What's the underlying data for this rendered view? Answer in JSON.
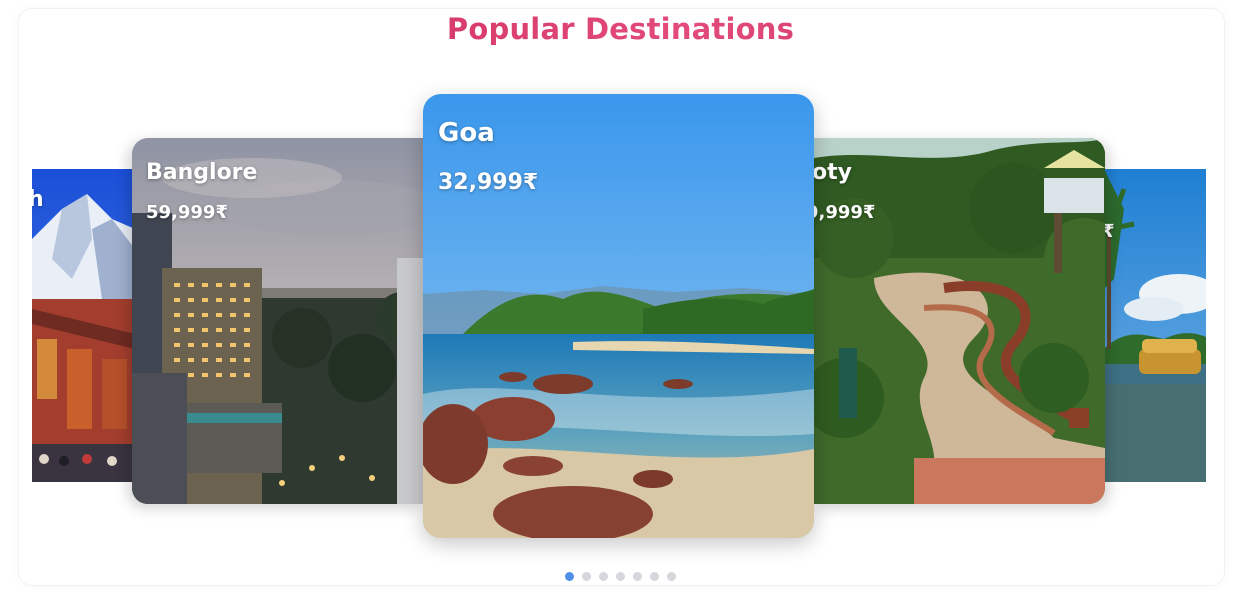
{
  "section": {
    "title": "Popular Destinations"
  },
  "cards": [
    {
      "name": "h",
      "price": ""
    },
    {
      "name": "Banglore",
      "price": "59,999₹"
    },
    {
      "name": "Goa",
      "price": "32,999₹"
    },
    {
      "name": "oty",
      "price": "9,999₹"
    },
    {
      "name": "",
      "price": "₹"
    }
  ],
  "pagination": {
    "total": 7,
    "active_index": 0
  },
  "colors": {
    "title": "#c92a58",
    "active_dot": "#4f8fe8",
    "inactive_dot": "#d6d6dc"
  }
}
